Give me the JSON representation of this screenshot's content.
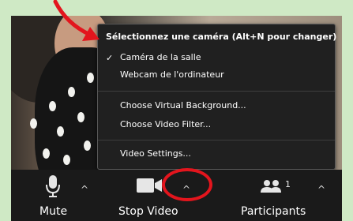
{
  "menu": {
    "title": "Sélectionnez une caméra (Alt+N pour changer)",
    "cameras": [
      {
        "label": "Caméra de la salle",
        "checked": true
      },
      {
        "label": "Webcam de l'ordinateur",
        "checked": false
      }
    ],
    "checkmark": "✓",
    "background_item": "Choose Virtual Background...",
    "filter_item": "Choose Video Filter...",
    "settings_item": "Video Settings..."
  },
  "toolbar": {
    "mute_label": "Mute",
    "stop_video_label": "Stop Video",
    "participants_label": "Participants",
    "participants_count": "1",
    "caret": "^"
  },
  "colors": {
    "annotation": "#e3151d",
    "toolbar_bg": "#1a1a1a",
    "menu_bg": "#202020",
    "frame_bg": "#cfe9c5"
  }
}
